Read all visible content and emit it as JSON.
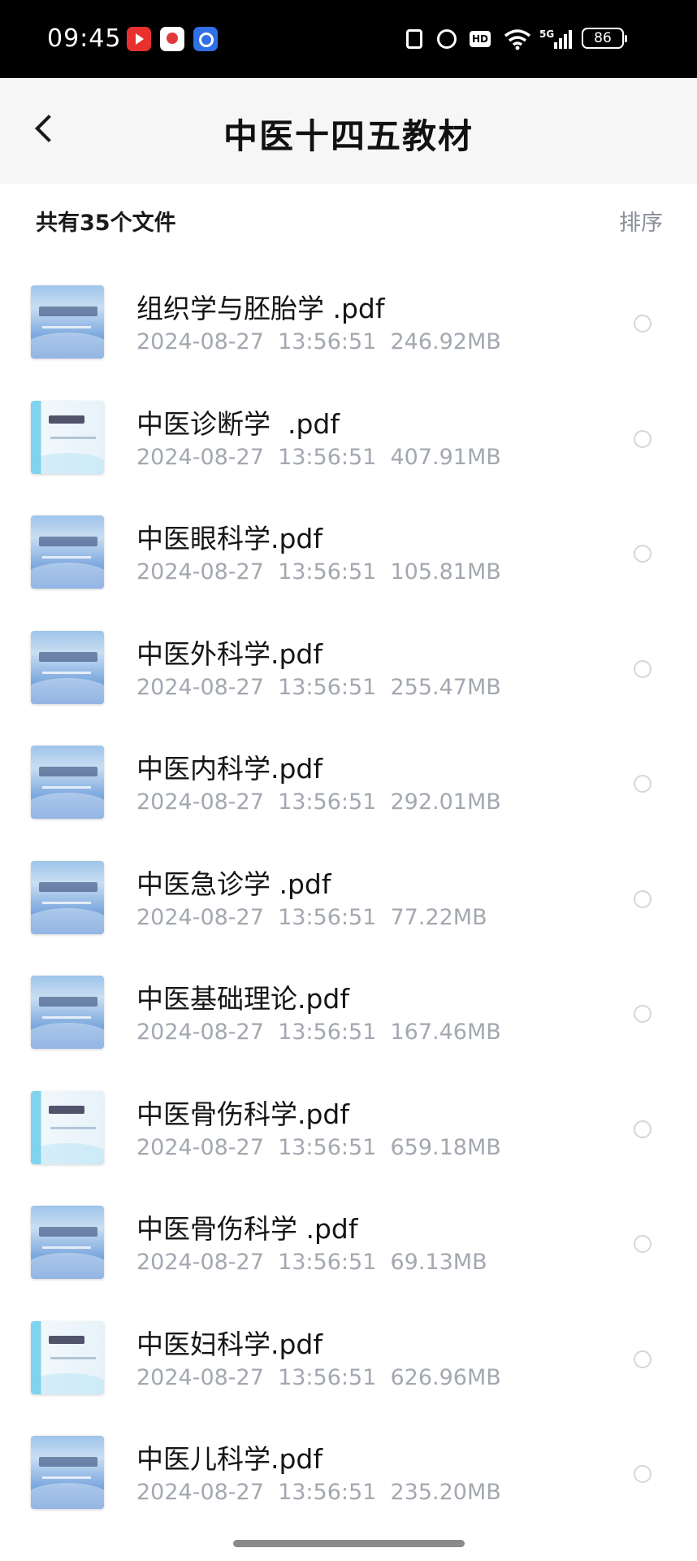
{
  "status_bar": {
    "time": "09:45",
    "battery": "86",
    "hd_label": "HD",
    "app_icons": [
      "video-app-icon",
      "red-app-icon",
      "browser-app-icon"
    ],
    "system_icons": [
      "nfc-icon",
      "alarm-icon",
      "hd-icon",
      "wifi-icon",
      "5g-signal-icon",
      "battery-icon"
    ]
  },
  "header": {
    "title": "中医十四五教材",
    "back_icon": "chevron-left-icon"
  },
  "summary": {
    "file_count_label": "共有35个文件",
    "sort_label": "排序"
  },
  "files": [
    {
      "name": "组织学与胚胎学 .pdf",
      "date": "2024-08-27",
      "time": "13:56:51",
      "size": "246.92MB",
      "meta": "2024-08-27  13:56:51  246.92MB",
      "thumb": "blue"
    },
    {
      "name": "中医诊断学  .pdf",
      "date": "2024-08-27",
      "time": "13:56:51",
      "size": "407.91MB",
      "meta": "2024-08-27  13:56:51  407.91MB",
      "thumb": "light"
    },
    {
      "name": "中医眼科学.pdf",
      "date": "2024-08-27",
      "time": "13:56:51",
      "size": "105.81MB",
      "meta": "2024-08-27  13:56:51  105.81MB",
      "thumb": "blue"
    },
    {
      "name": "中医外科学.pdf",
      "date": "2024-08-27",
      "time": "13:56:51",
      "size": "255.47MB",
      "meta": "2024-08-27  13:56:51  255.47MB",
      "thumb": "blue"
    },
    {
      "name": "中医内科学.pdf",
      "date": "2024-08-27",
      "time": "13:56:51",
      "size": "292.01MB",
      "meta": "2024-08-27  13:56:51  292.01MB",
      "thumb": "blue"
    },
    {
      "name": "中医急诊学 .pdf",
      "date": "2024-08-27",
      "time": "13:56:51",
      "size": "77.22MB",
      "meta": "2024-08-27  13:56:51  77.22MB",
      "thumb": "blue"
    },
    {
      "name": "中医基础理论.pdf",
      "date": "2024-08-27",
      "time": "13:56:51",
      "size": "167.46MB",
      "meta": "2024-08-27  13:56:51  167.46MB",
      "thumb": "blue"
    },
    {
      "name": "中医骨伤科学.pdf",
      "date": "2024-08-27",
      "time": "13:56:51",
      "size": "659.18MB",
      "meta": "2024-08-27  13:56:51  659.18MB",
      "thumb": "light"
    },
    {
      "name": "中医骨伤科学 .pdf",
      "date": "2024-08-27",
      "time": "13:56:51",
      "size": "69.13MB",
      "meta": "2024-08-27  13:56:51  69.13MB",
      "thumb": "blue"
    },
    {
      "name": "中医妇科学.pdf",
      "date": "2024-08-27",
      "time": "13:56:51",
      "size": "626.96MB",
      "meta": "2024-08-27  13:56:51  626.96MB",
      "thumb": "light"
    },
    {
      "name": "中医儿科学.pdf",
      "date": "2024-08-27",
      "time": "13:56:51",
      "size": "235.20MB",
      "meta": "2024-08-27  13:56:51  235.20MB",
      "thumb": "blue"
    }
  ],
  "colors": {
    "status_bar_bg": "#000000",
    "header_bg": "#f6f6f6",
    "secondary_text": "#a3a8b0",
    "sort_text": "#8a8f99"
  }
}
